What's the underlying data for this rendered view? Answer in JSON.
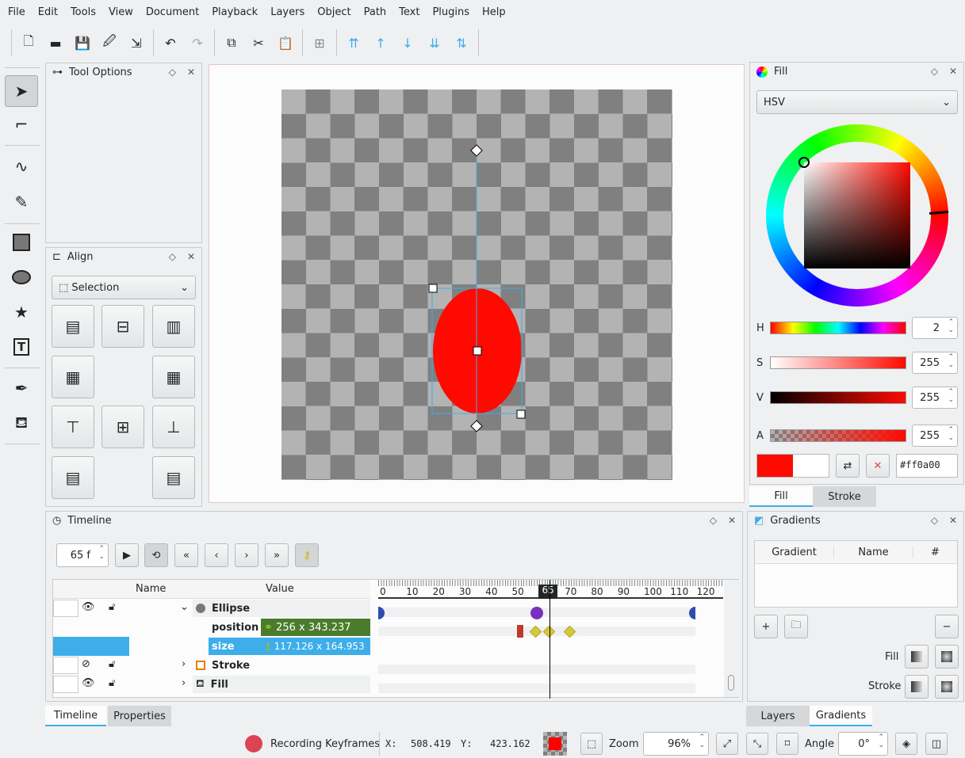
{
  "menu": [
    "File",
    "Edit",
    "Tools",
    "View",
    "Document",
    "Playback",
    "Layers",
    "Object",
    "Path",
    "Text",
    "Plugins",
    "Help"
  ],
  "toolbar_icons": [
    "new-file-icon",
    "open-icon",
    "save-icon",
    "save-as-icon",
    "export-icon",
    "undo-icon",
    "redo-icon",
    "copy-icon",
    "cut-icon",
    "paste-icon",
    "group-icon",
    "raise-to-top-icon",
    "raise-icon",
    "lower-icon",
    "lower-to-bottom-icon",
    "move-to-icon"
  ],
  "tools": [
    "select-tool-icon",
    "edit-node-tool-icon",
    "bezier-tool-icon",
    "draw-freehand-icon",
    "rectangle-tool-icon",
    "ellipse-tool-icon",
    "star-tool-icon",
    "text-tool-icon",
    "color-picker-icon",
    "fill-tool-icon"
  ],
  "tool_options": {
    "title": "Tool Options"
  },
  "align": {
    "title": "Align",
    "relative_to": "Selection"
  },
  "fill": {
    "title": "Fill",
    "mode": "HSV",
    "h_label": "H",
    "h": "2",
    "s_label": "S",
    "s": "255",
    "v_label": "V",
    "v": "255",
    "a_label": "A",
    "a": "255",
    "hex": "#ff0a00",
    "color": "#ff0a00",
    "tabs": [
      "Fill",
      "Stroke"
    ]
  },
  "timeline": {
    "title": "Timeline",
    "frame": "65 f",
    "ruler": [
      "0",
      "10",
      "20",
      "30",
      "40",
      "50",
      "65",
      "70",
      "80",
      "90",
      "100",
      "110",
      "120"
    ],
    "headers": {
      "name": "Name",
      "value": "Value"
    },
    "rows": [
      {
        "name": "Ellipse",
        "value": ""
      },
      {
        "name": "position",
        "value": "256 x 343.237"
      },
      {
        "name": "size",
        "value": "117.126 x 164.953"
      },
      {
        "name": "Stroke",
        "value": ""
      },
      {
        "name": "Fill",
        "value": ""
      }
    ],
    "tabs": [
      "Timeline",
      "Properties"
    ]
  },
  "gradients": {
    "title": "Gradients",
    "headers": [
      "Gradient",
      "Name",
      "#"
    ],
    "fill_label": "Fill",
    "stroke_label": "Stroke",
    "tabs": [
      "Layers",
      "Gradients"
    ]
  },
  "status": {
    "recording": "Recording Keyframes",
    "x_label": "X:",
    "x": "508.419",
    "y_label": "Y:",
    "y": "423.162",
    "zoom_label": "Zoom",
    "zoom": "96%",
    "angle_label": "Angle",
    "angle": "0°",
    "record_color": "#da4453"
  }
}
